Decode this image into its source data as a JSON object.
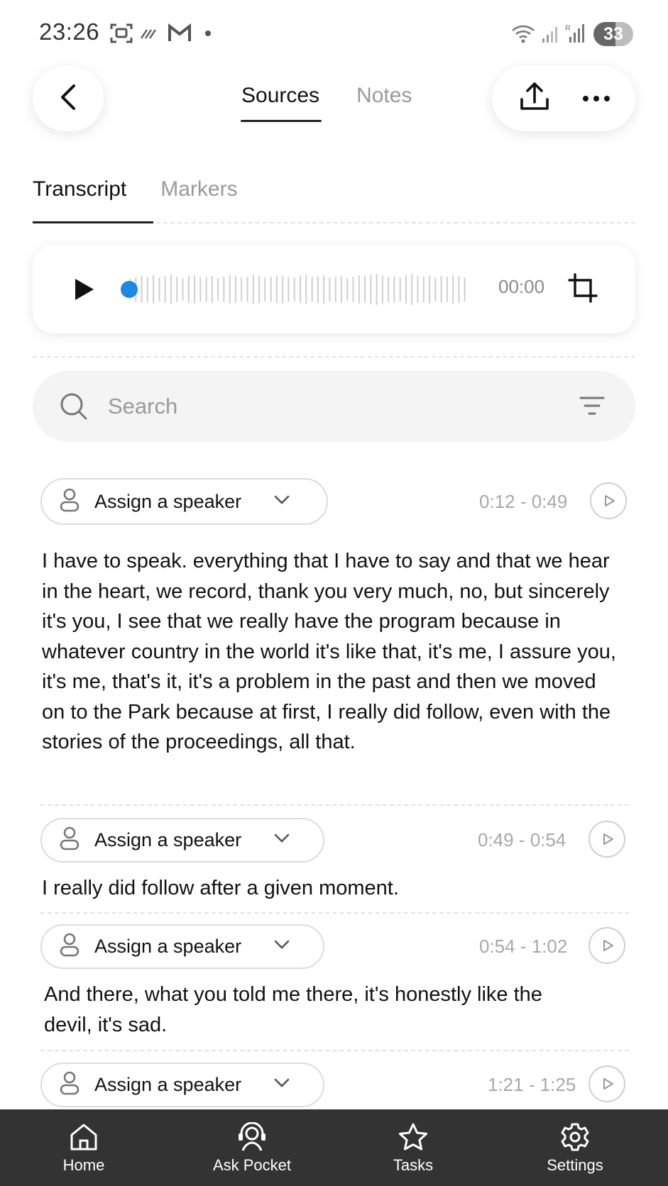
{
  "status_bar": {
    "time": "23:26",
    "battery": "33",
    "icons": [
      "screenshot-icon",
      "signal-burst-icon",
      "gmail-icon",
      "dot-icon",
      "wifi-icon",
      "cell-signal-icon",
      "cell-signal-roaming-icon"
    ]
  },
  "header": {
    "tabs": [
      "Sources",
      "Notes"
    ],
    "active_tab": "Sources",
    "icons": [
      "back-arrow-icon",
      "share-icon",
      "more-icon"
    ]
  },
  "sub_tabs": {
    "items": [
      "Transcript",
      "Markers"
    ],
    "active": "Transcript"
  },
  "player": {
    "time": "00:00",
    "progress": 0,
    "accent_color": "#1E88E5",
    "icons": [
      "play-icon",
      "crop-icon"
    ]
  },
  "search": {
    "placeholder": "Search",
    "value": "",
    "icons": [
      "search-icon",
      "filter-icon"
    ]
  },
  "segments": [
    {
      "speaker_label": "Assign a speaker",
      "range": "0:12 - 0:49",
      "text": "I have to speak. everything that I have to say and that we hear in the heart, we record, thank you very much, no, but sincerely it's you, I see that we really have the program because in whatever country in the world it's like that, it's me, I assure you, it's me, that's it, it's a problem in the past and then we moved on to the Park because at first, I really did follow, even with the stories of the proceedings, all that."
    },
    {
      "speaker_label": "Assign a speaker",
      "range": "0:49 - 0:54",
      "text": "I really did follow after a given moment."
    },
    {
      "speaker_label": "Assign a speaker",
      "range": "0:54 - 1:02",
      "text": "And there, what you told me there, it's honestly like the devil, it's sad."
    },
    {
      "speaker_label": "Assign a speaker",
      "range": "1:21 - 1:25",
      "text": ""
    }
  ],
  "bottom_nav": [
    {
      "label": "Home",
      "icon": "home-icon"
    },
    {
      "label": "Ask Pocket",
      "icon": "assistant-headset-icon"
    },
    {
      "label": "Tasks",
      "icon": "star-icon"
    },
    {
      "label": "Settings",
      "icon": "gear-icon"
    }
  ],
  "colors": {
    "nav_background": "#333333",
    "text": "#111111",
    "muted": "#9a9a9a"
  }
}
